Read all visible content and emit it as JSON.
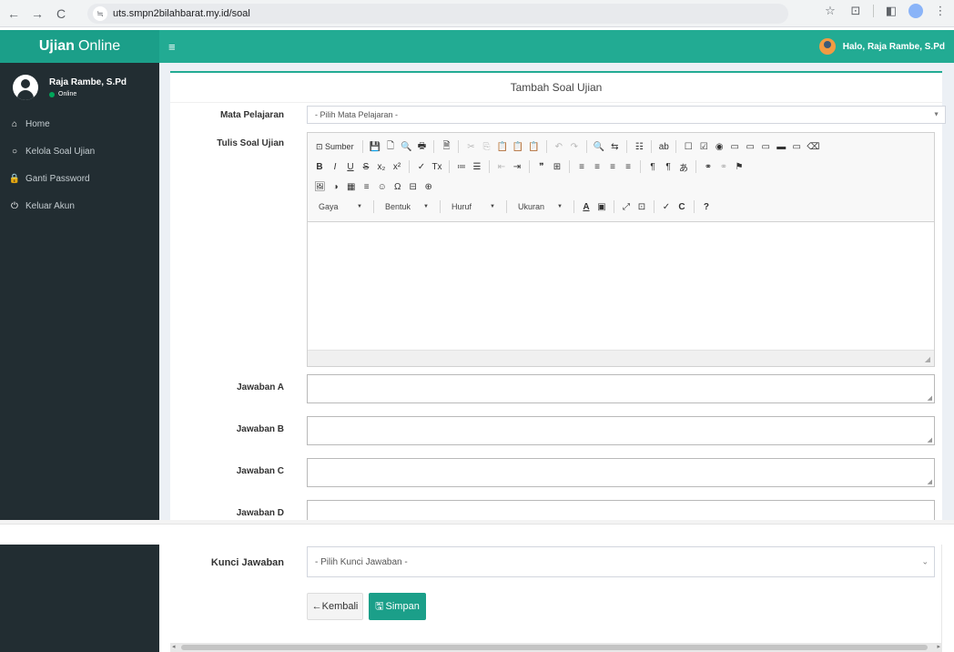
{
  "browser": {
    "url": "uts.smpn2bilahbarat.my.id/soal",
    "back": "←",
    "forward": "→",
    "reload": "C",
    "site_info": "≒",
    "star": "☆",
    "extensions": "⊡",
    "sidepanel": "◧",
    "menu": "⋮"
  },
  "header": {
    "brand_bold": "Ujian",
    "brand_light": "Online",
    "menu_toggle": "≡",
    "greeting": "Halo, Raja Rambe, S.Pd"
  },
  "sidebar": {
    "user_name": "Raja Rambe, S.Pd",
    "status": "Online",
    "items": [
      {
        "icon": "home-icon",
        "glyph": "⌂",
        "label": "Home"
      },
      {
        "icon": "circle-icon",
        "glyph": "○",
        "label": "Kelola Soal Ujian"
      },
      {
        "icon": "lock-icon",
        "glyph": "🔒",
        "label": "Ganti Password"
      },
      {
        "icon": "power-icon",
        "glyph": "⏻",
        "label": "Keluar Akun"
      }
    ]
  },
  "form": {
    "title": "Tambah Soal Ujian",
    "mata_pelajaran_label": "Mata Pelajaran",
    "mata_pelajaran_value": "- Pilih Mata Pelajaran -",
    "tulis_soal_label": "Tulis Soal Ujian",
    "jawaban_a_label": "Jawaban A",
    "jawaban_b_label": "Jawaban B",
    "jawaban_c_label": "Jawaban C",
    "jawaban_d_label": "Jawaban D",
    "kunci_jawaban_label": "Kunci Jawaban",
    "kunci_jawaban_value": "- Pilih Kunci Jawaban -",
    "back_label": "Kembali",
    "save_label": "Simpan"
  },
  "editor": {
    "source_label": "Sumber",
    "combos": [
      "Gaya",
      "Bentuk",
      "Huruf",
      "Ukuran"
    ],
    "row1": [
      "💾",
      "🗋",
      "🔍",
      "🖶",
      "🗎",
      "✂",
      "⎘",
      "📋",
      "📋",
      "📋",
      "↶",
      "↷",
      "🔍",
      "⇆",
      "☷",
      "ab",
      "☐",
      "☑",
      "◉",
      "▭",
      "▭",
      "▭",
      "▬",
      "▭",
      "⌫"
    ],
    "row2": [
      "B",
      "I",
      "U",
      "S",
      "x₂",
      "x²",
      "✓",
      "Tx",
      "≔",
      "☰",
      "⇤",
      "⇥",
      "❞",
      "⊞",
      "≡",
      "≡",
      "≡",
      "≡",
      "¶",
      "¶",
      "あ",
      "⚭",
      "⚭",
      "⚑"
    ],
    "row3": [
      "🖼",
      "◑",
      "▦",
      "≡",
      "☺",
      "Ω",
      "⊟",
      "⊕"
    ],
    "row4_extra": [
      "A",
      "▣",
      "⤢",
      "⊡",
      "✓",
      "C",
      "?"
    ]
  }
}
